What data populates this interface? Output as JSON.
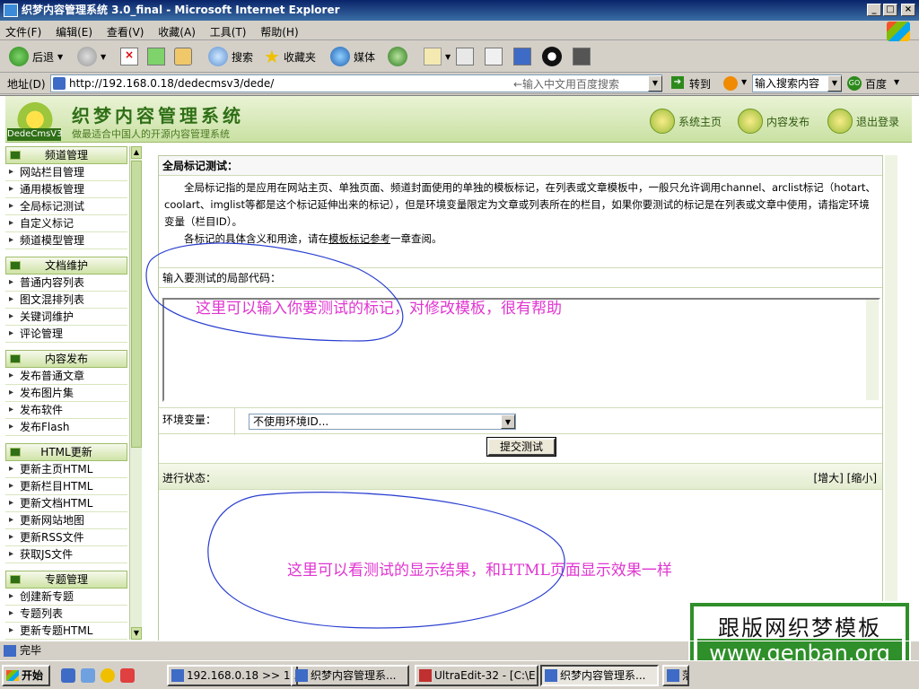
{
  "window": {
    "title": "织梦内容管理系统 3.0_final - Microsoft Internet Explorer"
  },
  "menu": [
    "文件(F)",
    "编辑(E)",
    "查看(V)",
    "收藏(A)",
    "工具(T)",
    "帮助(H)"
  ],
  "toolbar": {
    "back": "后退",
    "search": "搜索",
    "favorites": "收藏夹",
    "media": "媒体"
  },
  "address": {
    "label": "地址(D)",
    "url": "http://192.168.0.18/dedecmsv3/dede/",
    "hint": "←输入中文用百度搜索",
    "go": "转到",
    "search_placeholder": "输入搜索内容",
    "baidu": "百度"
  },
  "header": {
    "brand": "织梦内容管理系统",
    "slogan": "做最适合中国人的开源内容管理系统",
    "tag": "DedeCmsV3",
    "nav": [
      "系统主页",
      "内容发布",
      "退出登录"
    ]
  },
  "sidebar": [
    {
      "title": "频道管理",
      "items": [
        "网站栏目管理",
        "通用模板管理",
        "全局标记测试",
        "自定义标记",
        "频道模型管理"
      ]
    },
    {
      "title": "文档维护",
      "items": [
        "普通内容列表",
        "图文混排列表",
        "关键词维护",
        "评论管理"
      ]
    },
    {
      "title": "内容发布",
      "items": [
        "发布普通文章",
        "发布图片集",
        "发布软件",
        "发布Flash"
      ]
    },
    {
      "title": "HTML更新",
      "items": [
        "更新主页HTML",
        "更新栏目HTML",
        "更新文档HTML",
        "更新网站地图",
        "更新RSS文件",
        "获取JS文件"
      ]
    },
    {
      "title": "专题管理",
      "items": [
        "创建新专题",
        "专题列表",
        "更新专题HTML"
      ]
    }
  ],
  "main": {
    "title": "全局标记测试：",
    "desc1": "全局标记指的是应用在网站主页、单独页面、频道封面使用的单独的模板标记，在列表或文章模板中，一般只允许调用channel、arclist标记（hotart、coolart、imglist等都是这个标记延伸出来的标记），但是环境变量限定为文章或列表所在的栏目，如果你要测试的标记是在列表或文章中使用，请指定环境变量（栏目ID）。",
    "desc2_pre": "各标记的具体含义和用途，请在",
    "desc2_link": "模板标记参考",
    "desc2_post": "一章查阅。",
    "input_label": "输入要测试的局部代码：",
    "env_label": "环境变量：",
    "env_value": "不使用环境ID...",
    "submit": "提交测试",
    "status_label": "进行状态：",
    "zoom": "[增大] [缩小]"
  },
  "annotations": {
    "note1": "这里可以输入你要测试的标记，对修改模板，很有帮助",
    "note2": "这里可以看测试的显示结果，和HTML页面显示效果一样",
    "color": "#e035d0"
  },
  "watermark": {
    "line1": "跟版网织梦模板",
    "line2": "www.genban.org"
  },
  "statusbar": {
    "text": "完毕"
  },
  "taskbar": {
    "start": "开始",
    "tasks": [
      "192.168.0.18 >> 1...",
      "织梦内容管理系...",
      "UltraEdit-32 - [C:\\E...",
      "织梦内容管理系...",
      "落"
    ]
  }
}
